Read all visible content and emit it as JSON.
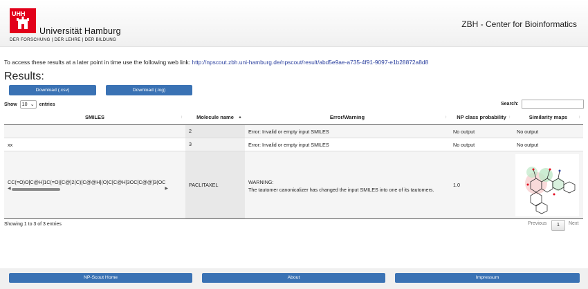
{
  "header": {
    "logo_initials": "UHH",
    "university_name": "Universität Hamburg",
    "university_tagline": "DER FORSCHUNG | DER LEHRE | DER BILDUNG",
    "center_name": "ZBH - Center for Bioinformatics"
  },
  "access": {
    "text": "To access these results at a later point in time use the following web link: ",
    "url": "http://npscout.zbh.uni-hamburg.de/npscout/result/abd5e9ae-a735-4f91-9097-e1b28872a8d8"
  },
  "results_title": "Results:",
  "downloads": {
    "csv": "Download (.csv)",
    "log": "Download (.log)"
  },
  "length_menu": {
    "show": "Show",
    "value": "10",
    "entries": "entries"
  },
  "search": {
    "label": "Search:",
    "value": ""
  },
  "table": {
    "columns": [
      "SMILES",
      "Molecule name",
      "Error/Warning",
      "NP class probability",
      "Similarity maps"
    ],
    "rows": [
      {
        "smiles": "",
        "name": "2",
        "message": "Error: Invalid or empty input SMILES",
        "message2": "",
        "prob": "No output",
        "map": "No output"
      },
      {
        "smiles": "xx",
        "name": "3",
        "message": "Error: Invalid or empty input SMILES",
        "message2": "",
        "prob": "No output",
        "map": "No output"
      },
      {
        "smiles": "CC(=O)O[C@H]1C(=O)[C@]2(C)[C@@H](O)C[C@H]3OC[C@@]3(OC",
        "name": "PACLITAXEL",
        "message": "WARNING:",
        "message2": "The tautomer canonicalizer has changed the input SMILES into one of its tautomers.",
        "prob": "1.0",
        "map": ""
      }
    ]
  },
  "table_info": "Showing 1 to 3 of 3 entries",
  "pagination": {
    "previous": "Previous",
    "current": "1",
    "next": "Next"
  },
  "footer": {
    "home": "NP-Scout Home",
    "about": "About",
    "impressum": "Impressum"
  },
  "colors": {
    "brand_red": "#e2001a",
    "button_blue": "#3a72b4",
    "link_blue": "#2a3f9e"
  }
}
